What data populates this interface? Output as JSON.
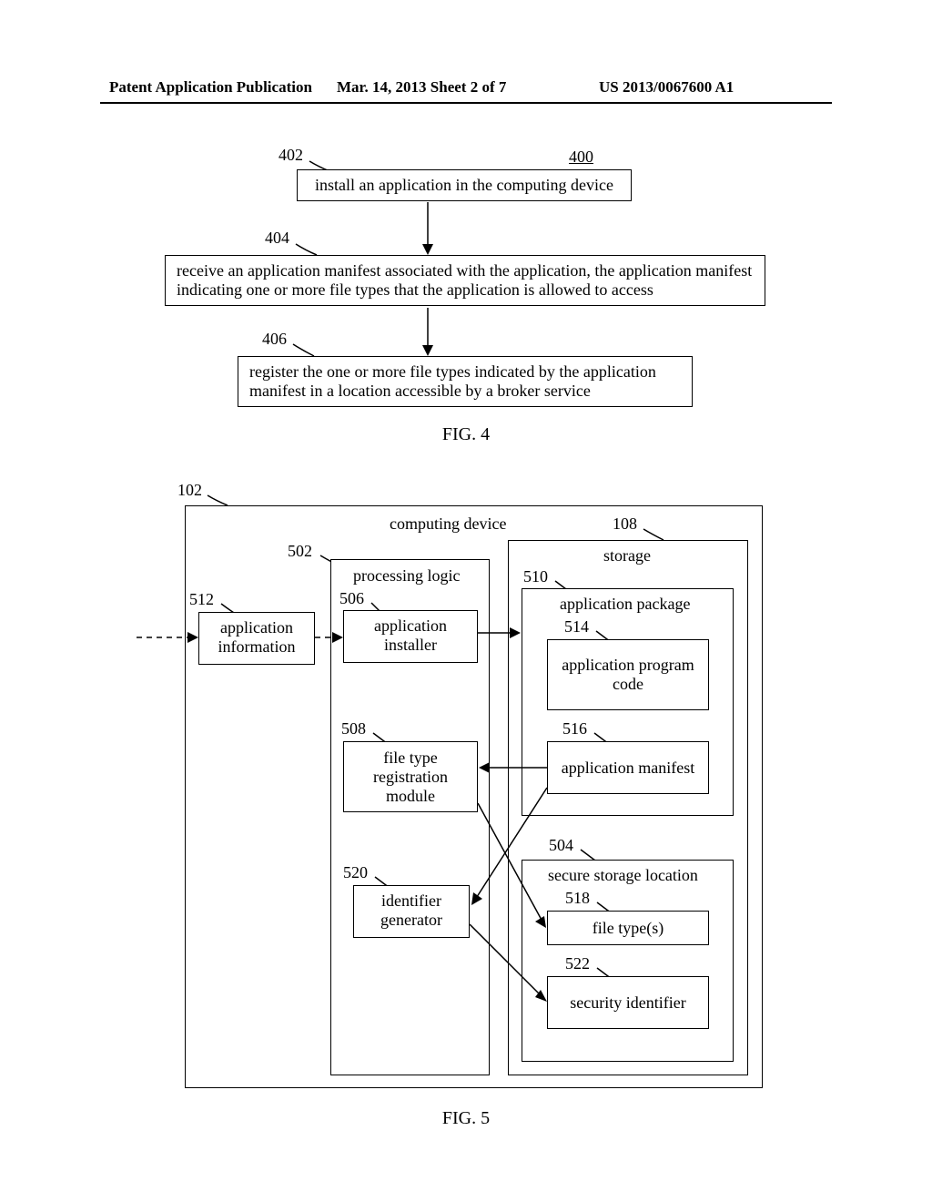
{
  "header": {
    "left": "Patent Application Publication",
    "center": "Mar. 14, 2013  Sheet 2 of 7",
    "right": "US 2013/0067600 A1"
  },
  "fig4": {
    "ref400": "400",
    "ref402": "402",
    "ref404": "404",
    "ref406": "406",
    "box402": "install an application in the computing device",
    "box404": "receive an application manifest associated with the application, the application manifest indicating one or more file types that the application is allowed to access",
    "box406": "register the one or more file types indicated by the application manifest in a location accessible by a broker service",
    "label": "FIG. 4"
  },
  "fig5": {
    "ref102": "102",
    "ref108": "108",
    "ref502": "502",
    "ref504": "504",
    "ref506": "506",
    "ref508": "508",
    "ref510": "510",
    "ref512": "512",
    "ref514": "514",
    "ref516": "516",
    "ref518": "518",
    "ref520": "520",
    "ref522": "522",
    "computing_device": "computing device",
    "processing_logic": "processing logic",
    "storage": "storage",
    "application_information": "application information",
    "application_installer": "application installer",
    "application_package": "application package",
    "application_program_code": "application program code",
    "file_type_registration_module": "file type registration module",
    "application_manifest": "application manifest",
    "identifier_generator": "identifier generator",
    "secure_storage_location": "secure storage location",
    "file_types": "file type(s)",
    "security_identifier": "security identifier",
    "label": "FIG. 5"
  }
}
